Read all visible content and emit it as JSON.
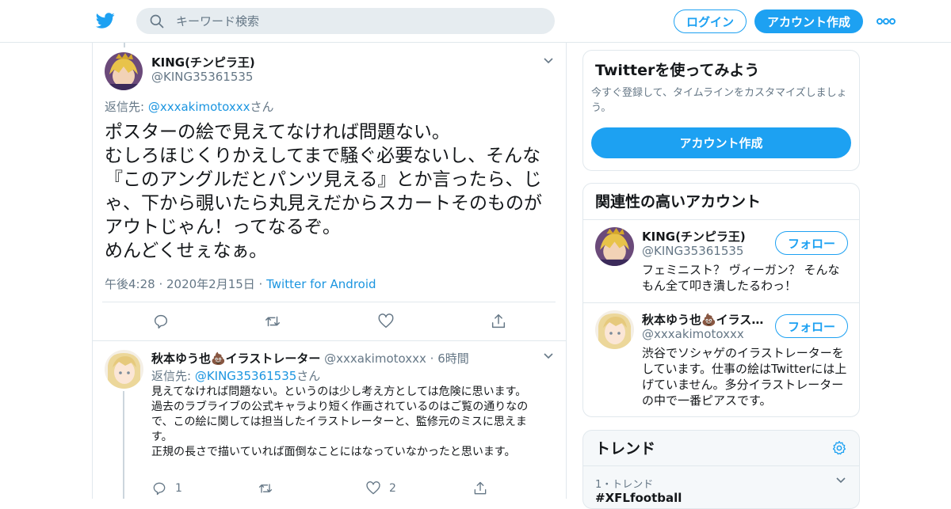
{
  "header": {
    "search_placeholder": "キーワード検索",
    "login_label": "ログイン",
    "signup_label": "アカウント作成"
  },
  "tweet": {
    "name": "KING(チンピラ王)",
    "handle": "@KING35361535",
    "reply_prefix": "返信先: ",
    "reply_to": "@xxxakimotoxxx",
    "reply_suffix": "さん",
    "text": "ポスターの絵で見えてなければ問題ない。\nむしろほじくりかえしてまで騒ぐ必要ないし、そんな『このアングルだとパンツ見える』とか言ったら、じゃ、下から覗いたら丸見えだからスカートそのものがアウトじゃん！ってなるぞ。\nめんどくせぇなぁ。",
    "time": "午後4:28 · 2020年2月15日 · ",
    "source": "Twitter for Android"
  },
  "reply": {
    "name": "秋本ゆう也💩イラストレーター",
    "handle": "@xxxakimotoxxx",
    "dot": " · ",
    "time": "6時間",
    "reply_prefix": "返信先: ",
    "reply_to": "@KING35361535",
    "reply_suffix": "さん",
    "text": "見えてなければ問題ない。というのは少し考え方としては危険に思います。\n過去のラブライブの公式キャラより短く作画されているのはご覧の通りなので、この絵に関しては担当したイラストレーターと、監修元のミスに思えます。\n正規の長さで描いていれば面倒なことにはなっていなかったと思います。",
    "reply_count": "1",
    "like_count": "2"
  },
  "sidebar": {
    "signup_card": {
      "title": "Twitterを使ってみよう",
      "subtitle": "今すぐ登録して、タイムラインをカスタマイズしましょう。",
      "button": "アカウント作成"
    },
    "accounts_card": {
      "title": "関連性の高いアカウント",
      "follow_label": "フォロー",
      "accounts": [
        {
          "name": "KING(チンピラ王)",
          "handle": "@KING35361535",
          "bio": "フェミニスト？ ヴィーガン？ そんなもん全て叩き潰したるわっ！"
        },
        {
          "name": "秋本ゆう也💩イラストレーター",
          "handle": "@xxxakimotoxxx",
          "bio": "渋谷でソシャゲのイラストレーターをしています。仕事の絵はTwitterには上げていません。多分イラストレーターの中で一番ピアスです。"
        }
      ]
    },
    "trends_card": {
      "title": "トレンド",
      "rank": "1・トレンド",
      "topic": "#XFLfootball"
    }
  },
  "colors": {
    "accent": "#1da1f2",
    "link": "#1b95e0",
    "muted": "#657786",
    "border": "#e1e8ed"
  }
}
